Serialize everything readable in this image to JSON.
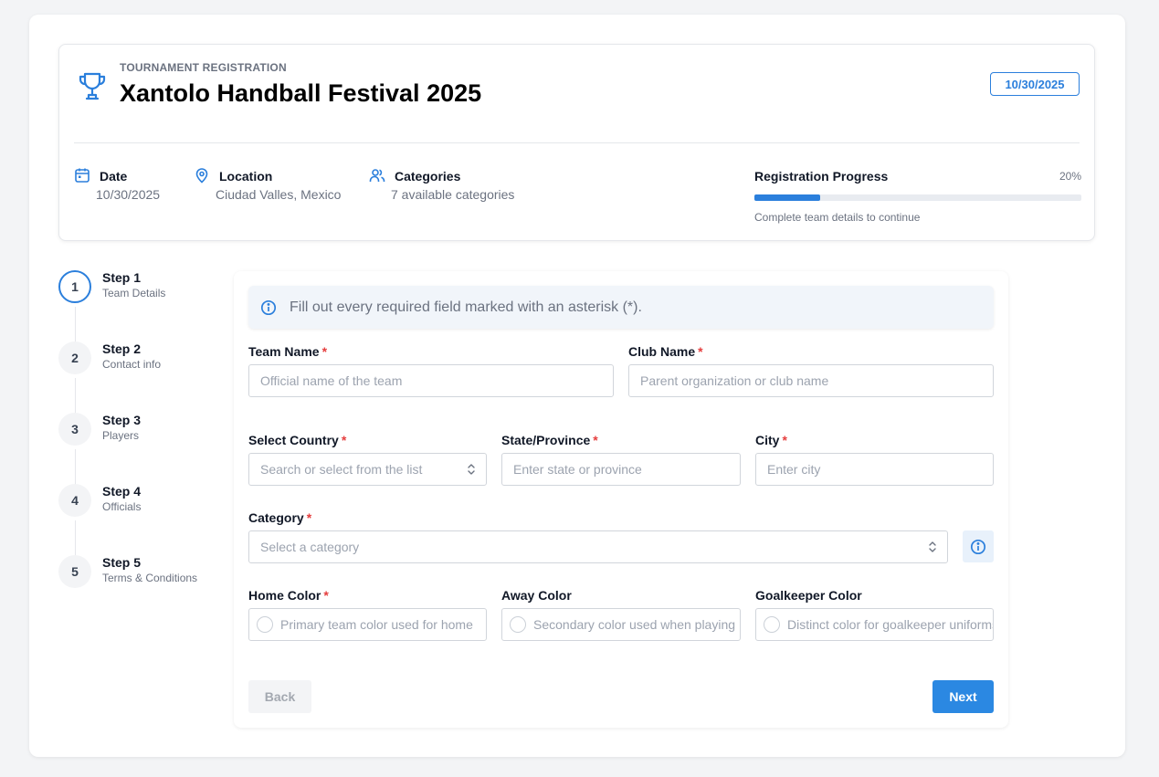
{
  "header": {
    "kicker": "TOURNAMENT REGISTRATION",
    "title": "Xantolo Handball Festival 2025",
    "date_badge": "10/30/2025"
  },
  "meta": {
    "date": {
      "label": "Date",
      "value": "10/30/2025",
      "icon": "calendar-icon"
    },
    "location": {
      "label": "Location",
      "value": "Ciudad Valles, Mexico",
      "icon": "map-pin-icon"
    },
    "categories": {
      "label": "Categories",
      "value": "7 available categories",
      "icon": "users-icon"
    }
  },
  "progress": {
    "title": "Registration Progress",
    "percent_label": "20%",
    "percent": 20,
    "hint": "Complete team details to continue"
  },
  "steps": [
    {
      "number": "1",
      "title": "Step 1",
      "subtitle": "Team Details",
      "active": true
    },
    {
      "number": "2",
      "title": "Step 2",
      "subtitle": "Contact info",
      "active": false
    },
    {
      "number": "3",
      "title": "Step 3",
      "subtitle": "Players",
      "active": false
    },
    {
      "number": "4",
      "title": "Step 4",
      "subtitle": "Officials",
      "active": false
    },
    {
      "number": "5",
      "title": "Step 5",
      "subtitle": "Terms & Conditions",
      "active": false
    }
  ],
  "form": {
    "notice": "Fill out every required field marked with an asterisk (*).",
    "required_mark": "*",
    "team_name": {
      "label": "Team Name",
      "placeholder": "Official name of the team"
    },
    "club_name": {
      "label": "Club Name",
      "placeholder": "Parent organization or club name"
    },
    "country": {
      "label": "Select Country",
      "placeholder": "Search or select from the list"
    },
    "state": {
      "label": "State/Province",
      "placeholder": "Enter state or province"
    },
    "city": {
      "label": "City",
      "placeholder": "Enter city"
    },
    "category": {
      "label": "Category",
      "placeholder": "Select a category"
    },
    "home_color": {
      "label": "Home Color",
      "placeholder": "Primary team color used for home"
    },
    "away_color": {
      "label": "Away Color",
      "placeholder": "Secondary color used when playing"
    },
    "gk_color": {
      "label": "Goalkeeper Color",
      "placeholder": "Distinct color for goalkeeper uniforms"
    }
  },
  "buttons": {
    "back": "Back",
    "next": "Next"
  },
  "colors": {
    "accent": "#2b7fdc",
    "required": "#e53e3e"
  }
}
